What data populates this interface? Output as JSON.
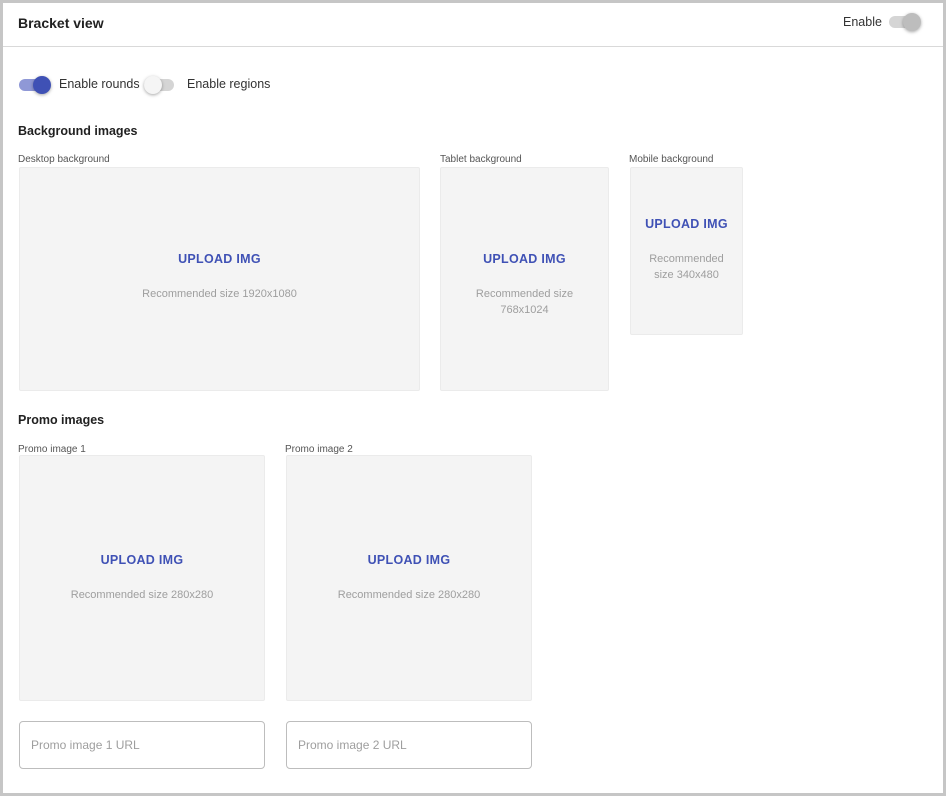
{
  "header": {
    "title": "Bracket view",
    "enable_label": "Enable",
    "enable_on": false
  },
  "toggles": {
    "rounds": {
      "label": "Enable rounds",
      "on": true
    },
    "regions": {
      "label": "Enable regions",
      "on": false
    }
  },
  "background_images": {
    "section_title": "Background images",
    "desktop": {
      "label": "Desktop background",
      "button": "UPLOAD IMG",
      "hint": "Recommended size 1920x1080"
    },
    "tablet": {
      "label": "Tablet background",
      "button": "UPLOAD IMG",
      "hint": "Recommended size 768x1024"
    },
    "mobile": {
      "label": "Mobile background",
      "button": "UPLOAD IMG",
      "hint": "Recommended size 340x480"
    }
  },
  "promo_images": {
    "section_title": "Promo images",
    "promo1": {
      "label": "Promo image 1",
      "button": "UPLOAD IMG",
      "hint": "Recommended size 280x280",
      "url_placeholder": "Promo image 1 URL",
      "url_value": ""
    },
    "promo2": {
      "label": "Promo image 2",
      "button": "UPLOAD IMG",
      "hint": "Recommended size 280x280",
      "url_placeholder": "Promo image 2 URL",
      "url_value": ""
    }
  },
  "colors": {
    "accent": "#3f51b5",
    "accent_track": "#8f98d6",
    "upload_bg": "#f4f4f4"
  }
}
